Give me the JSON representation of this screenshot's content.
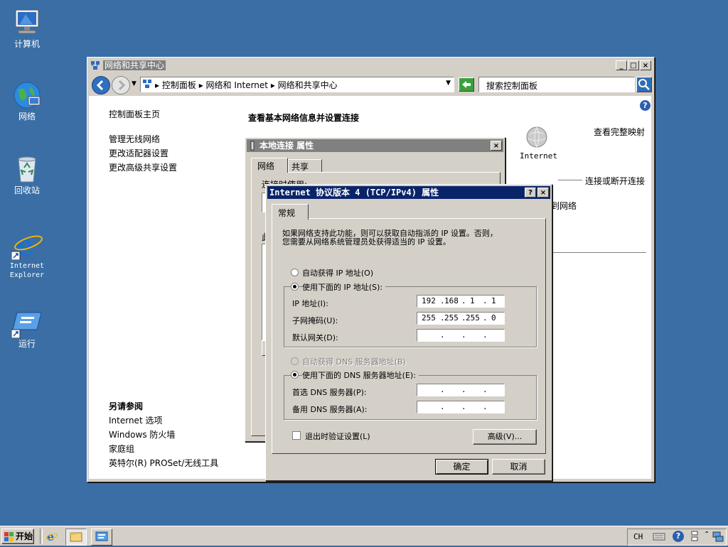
{
  "desktop": {
    "icons": [
      {
        "label": "计算机"
      },
      {
        "label": "网络"
      },
      {
        "label": "回收站"
      },
      {
        "label": "Internet Explorer"
      },
      {
        "label": "运行"
      }
    ]
  },
  "main_window": {
    "title": "网络和共享中心",
    "address": {
      "crumbs": [
        "控制面板",
        "网络和 Internet",
        "网络和共享中心"
      ],
      "search_placeholder": "搜索控制面板"
    },
    "left_nav": {
      "home": "控制面板主页",
      "tasks": [
        "管理无线网络",
        "更改适配器设置",
        "更改高级共享设置"
      ],
      "see_also_title": "另请参阅",
      "see_also": [
        "Internet 选项",
        "Windows 防火墙",
        "家庭组",
        "英特尔(R) PROSet/无线工具"
      ]
    },
    "content": {
      "heading": "查看基本网络信息并设置连接",
      "view_full_map": "查看完整映射",
      "internet_label": "Internet",
      "connect_disconnect": "连接或断开连接",
      "partial_network": "到网络"
    }
  },
  "lan_dialog": {
    "title": "本地连接 属性",
    "tabs": [
      "网络",
      "共享"
    ],
    "partial_text": "连接时使用:",
    "partial_text2": "此"
  },
  "ipv4_dialog": {
    "title": "Internet 协议版本 4 (TCP/IPv4) 属性",
    "tab": "常规",
    "description": [
      "如果网络支持此功能，则可以获取自动指派的 IP 设置。否则，",
      "您需要从网络系统管理员处获得适当的 IP 设置。"
    ],
    "auto_ip": "自动获得 IP 地址(O)",
    "manual_ip": "使用下面的 IP 地址(S):",
    "ip_label": "IP 地址(I):",
    "ip_value": [
      "192",
      "168",
      "1",
      "1"
    ],
    "mask_label": "子网掩码(U):",
    "mask_value": [
      "255",
      "255",
      "255",
      "0"
    ],
    "gateway_label": "默认网关(D):",
    "auto_dns": "自动获得 DNS 服务器地址(B)",
    "manual_dns": "使用下面的 DNS 服务器地址(E):",
    "pref_dns_label": "首选 DNS 服务器(P):",
    "alt_dns_label": "备用 DNS 服务器(A):",
    "validate_label": "退出时验证设置(L)",
    "advanced_button": "高级(V)...",
    "ok_button": "确定",
    "cancel_button": "取消"
  },
  "taskbar": {
    "start_label": "开始",
    "lang": "CH"
  }
}
